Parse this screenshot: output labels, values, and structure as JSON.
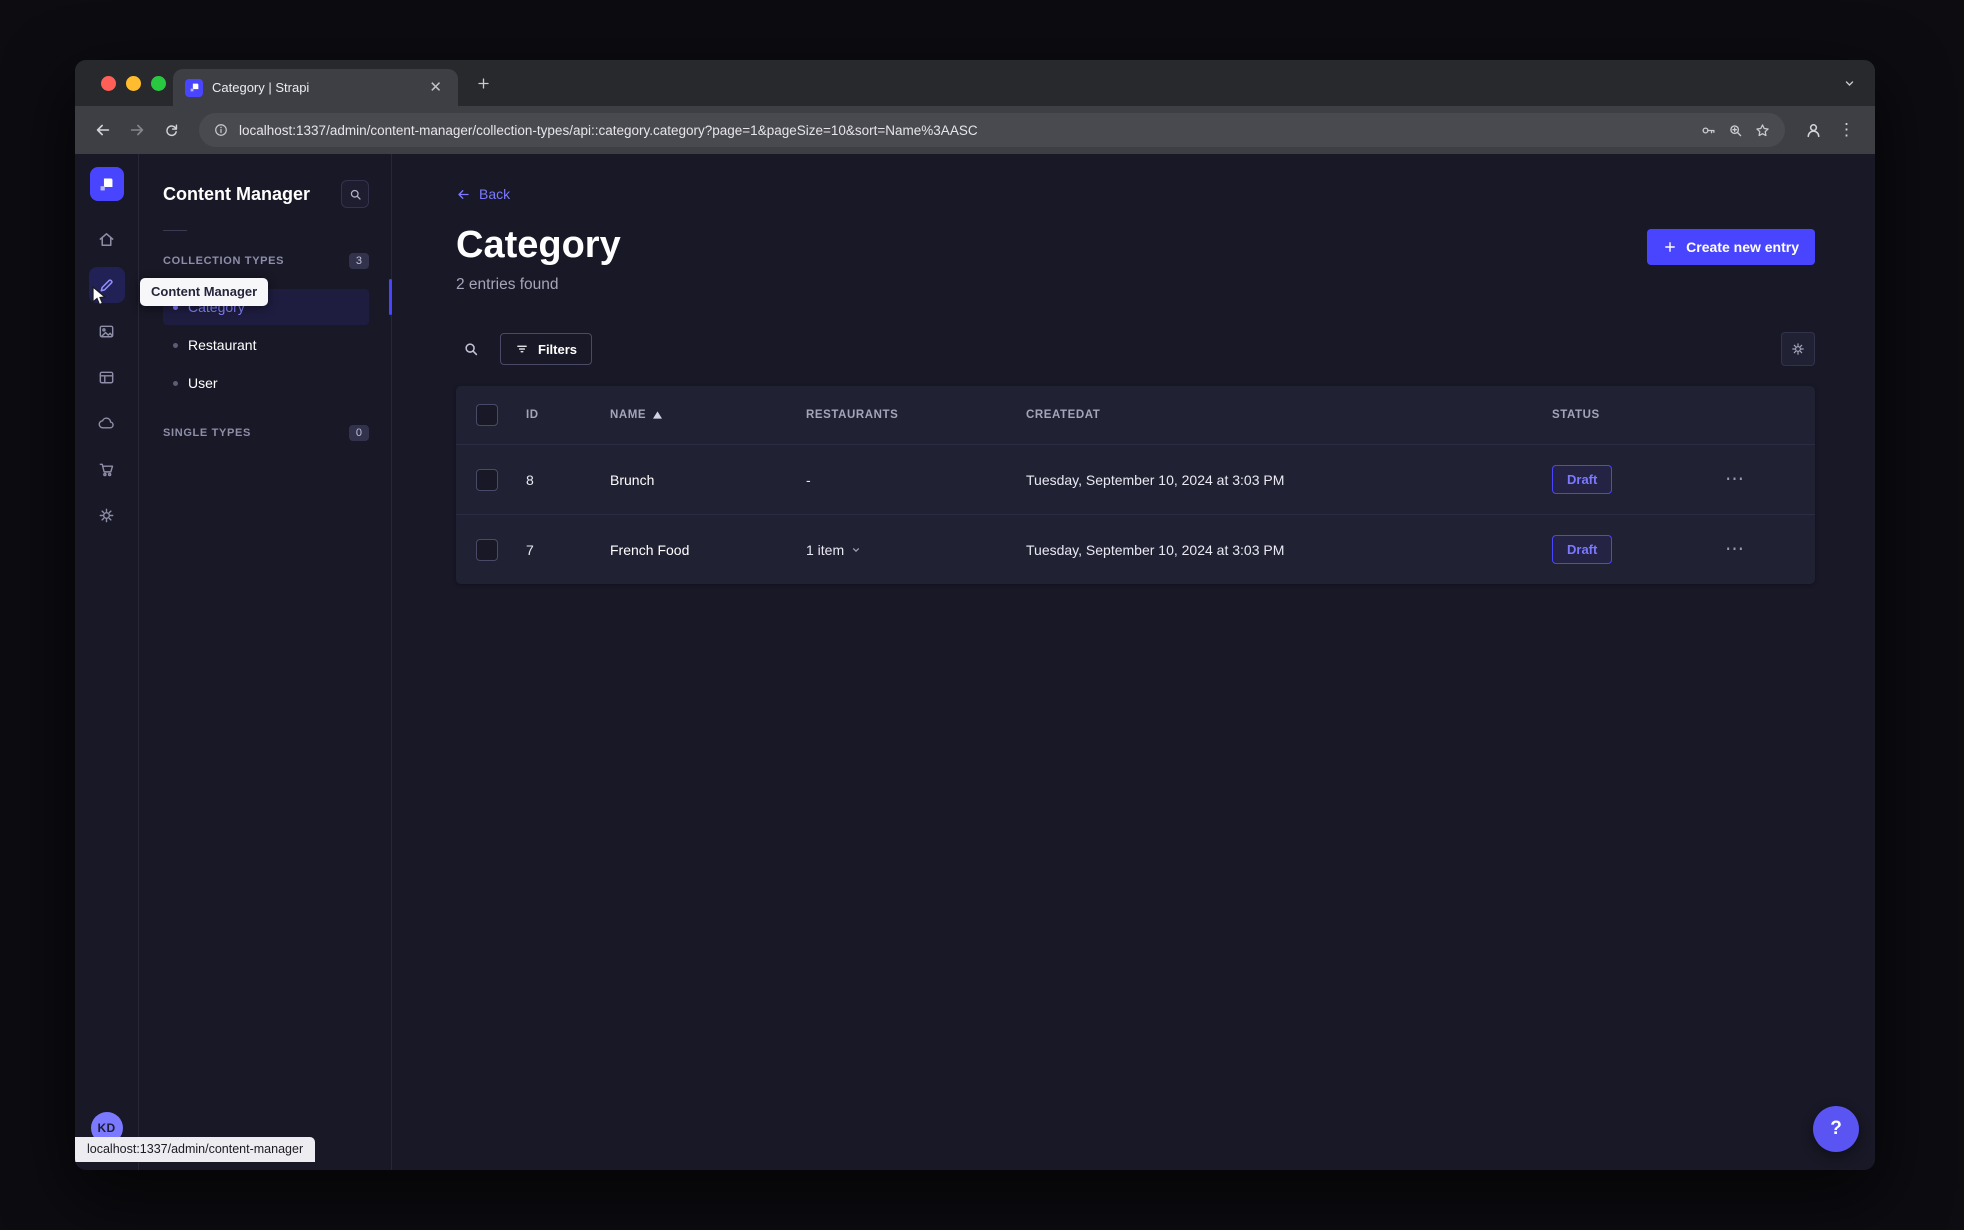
{
  "browser": {
    "tab_title": "Category | Strapi",
    "url": "localhost:1337/admin/content-manager/collection-types/api::category.category?page=1&pageSize=10&sort=Name%3AASC",
    "status_bubble": "localhost:1337/admin/content-manager"
  },
  "rail": {
    "avatar_initials": "KD"
  },
  "sidebar": {
    "title": "Content Manager",
    "collection_types_label": "COLLECTION TYPES",
    "collection_types_count": "3",
    "items": [
      {
        "label": "Category"
      },
      {
        "label": "Restaurant"
      },
      {
        "label": "User"
      }
    ],
    "single_types_label": "SINGLE TYPES",
    "single_types_count": "0"
  },
  "tooltip": {
    "text": "Content Manager"
  },
  "main": {
    "back_label": "Back",
    "title": "Category",
    "subtitle": "2 entries found",
    "create_button_label": "Create new entry",
    "filters_button_label": "Filters",
    "help_label": "?",
    "table": {
      "headers": {
        "id": "ID",
        "name": "NAME",
        "restaurants": "RESTAURANTS",
        "created_at": "CREATEDAT",
        "status": "STATUS"
      },
      "rows": [
        {
          "id": "8",
          "name": "Brunch",
          "restaurants": "-",
          "created_at": "Tuesday, September 10, 2024 at 3:03 PM",
          "status": "Draft"
        },
        {
          "id": "7",
          "name": "French Food",
          "restaurants": "1 item",
          "created_at": "Tuesday, September 10, 2024 at 3:03 PM",
          "status": "Draft"
        }
      ]
    }
  },
  "colors": {
    "primary": "#4945ff",
    "link": "#7b79ff"
  }
}
